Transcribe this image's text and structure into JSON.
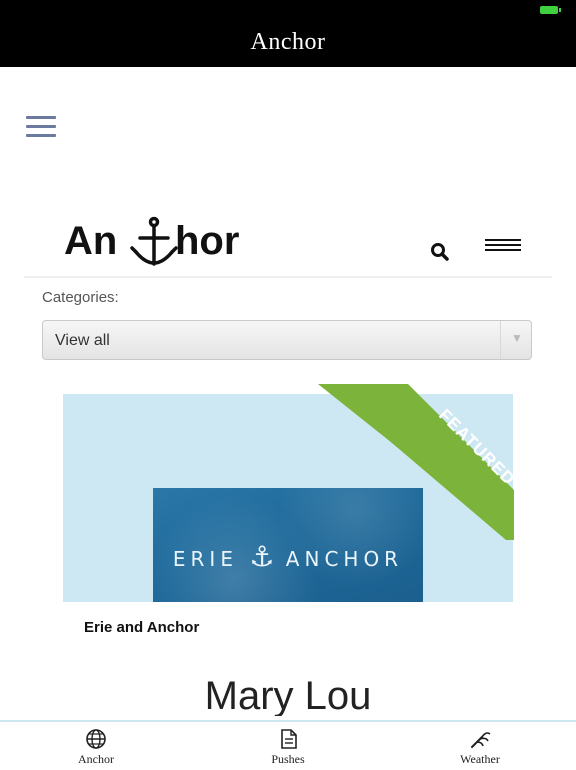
{
  "header": {
    "title": "Anchor"
  },
  "site": {
    "logo_text_left": "An",
    "logo_text_right": "hor",
    "categories_label": "Categories:",
    "category_selected": "View all"
  },
  "featured": {
    "ribbon_text": "FEATURED",
    "image_brand_left": "ERIE",
    "image_brand_right": "ANCHOR",
    "title": "Erie and Anchor"
  },
  "next_article": {
    "title": "Mary Lou"
  },
  "tabbar": {
    "tabs": [
      {
        "label": "Anchor",
        "icon": "globe-icon"
      },
      {
        "label": "Pushes",
        "icon": "document-icon"
      },
      {
        "label": "Weather",
        "icon": "wind-icon"
      }
    ]
  },
  "colors": {
    "ribbon": "#7cb33a",
    "tint": "#cde8f2",
    "accent": "#6b7a9e"
  }
}
